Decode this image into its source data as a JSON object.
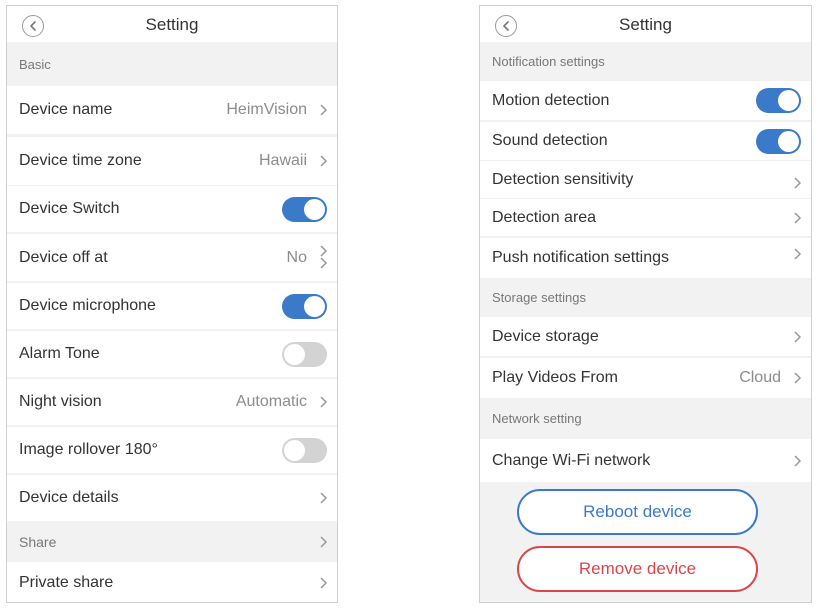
{
  "colors": {
    "accent": "#3b79c9",
    "danger": "#d9474a",
    "toggle_off": "#d3d3d3"
  },
  "left": {
    "title": "Setting",
    "sections": {
      "basic": "Basic",
      "share": "Share"
    },
    "items": {
      "device_name": {
        "label": "Device name",
        "value": "HeimVision"
      },
      "time_zone": {
        "label": "Device time zone",
        "value": "Hawaii"
      },
      "device_switch": {
        "label": "Device Switch",
        "toggle": "on"
      },
      "device_off_at": {
        "label": "Device off at",
        "value": "No"
      },
      "microphone": {
        "label": "Device microphone",
        "toggle": "on"
      },
      "alarm_tone": {
        "label": "Alarm Tone",
        "toggle": "off"
      },
      "night_vision": {
        "label": "Night vision",
        "value": "Automatic"
      },
      "image_rollover": {
        "label": "Image rollover 180°",
        "toggle": "off"
      },
      "device_details": {
        "label": "Device details"
      },
      "private_share": {
        "label": "Private share"
      }
    }
  },
  "right": {
    "title": "Setting",
    "sections": {
      "notification": "Notification settings",
      "storage": "Storage settings",
      "network": "Network setting"
    },
    "items": {
      "motion": {
        "label": "Motion detection",
        "toggle": "on"
      },
      "sound": {
        "label": "Sound detection",
        "toggle": "on"
      },
      "sensitivity": {
        "label": "Detection sensitivity"
      },
      "area": {
        "label": "Detection area"
      },
      "push": {
        "label": "Push notification settings"
      },
      "storage": {
        "label": "Device storage"
      },
      "play_from": {
        "label": "Play Videos From",
        "value": "Cloud"
      },
      "wifi": {
        "label": "Change Wi-Fi network"
      }
    },
    "buttons": {
      "reboot": "Reboot device",
      "remove": "Remove device"
    }
  }
}
